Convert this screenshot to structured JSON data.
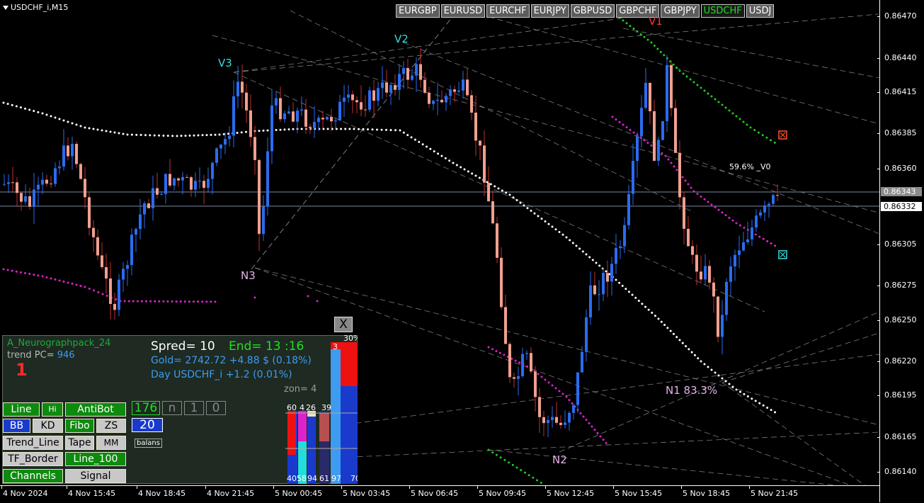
{
  "symbol": {
    "title": "USDCHF_i,M15"
  },
  "pairs": [
    {
      "label": "EURGBP",
      "active": false
    },
    {
      "label": "EURUSD",
      "active": false
    },
    {
      "label": "EURCHF",
      "active": false
    },
    {
      "label": "EURJPY",
      "active": false
    },
    {
      "label": "GBPUSD",
      "active": false
    },
    {
      "label": "GBPCHF",
      "active": false
    },
    {
      "label": "GBPJPY",
      "active": false
    },
    {
      "label": "USDCHF",
      "active": true
    },
    {
      "label": "USDJ",
      "active": false
    }
  ],
  "price_axis": {
    "labels": [
      "0.86470",
      "0.86440",
      "0.86415",
      "0.86385",
      "0.86360",
      "0.86305",
      "0.86275",
      "0.86250",
      "0.86220",
      "0.86195",
      "0.86165",
      "0.86140"
    ],
    "marker_upper": "0.86343",
    "marker_lower": "0.86332"
  },
  "time_axis": {
    "labels": [
      "4 Nov 2024",
      "4 Nov 15:45",
      "4 Nov 18:45",
      "4 Nov 21:45",
      "5 Nov 00:45",
      "5 Nov 03:45",
      "5 Nov 06:45",
      "5 Nov 09:45",
      "5 Nov 12:45",
      "5 Nov 15:45",
      "5 Nov 18:45",
      "5 Nov 21:45"
    ]
  },
  "wave_labels": {
    "v1": "V1",
    "v2": "V2",
    "v3": "V3",
    "n1": "N1 83.3%",
    "n2": "N2",
    "n3": "N3",
    "fib": "59.6% _V0"
  },
  "panel": {
    "indicator_name": "A_Neurographpack_24",
    "trend_pc_label": "trend PC=",
    "trend_pc_value": "946",
    "signal_number": "1",
    "spred": "Spred= 10",
    "end": "End= 13 :16",
    "gold": "Gold= 2742.72 +4.88 $ (0.18%)",
    "day": "Day USDCHF_i   +1.2 (0.01%)",
    "zon": "zon= 4",
    "close_label": "X",
    "balans": "balans",
    "buttons": {
      "line": "Line",
      "hi": "Hi",
      "antibot": "AntiBot",
      "bb": "BB",
      "kd": "KD",
      "fibo": "Fibo",
      "zs": "ZS",
      "trend_line": "Trend_Line",
      "tape": "Tape",
      "mm": "MM",
      "tf_border": "TF_Border",
      "line_100": "Line_100",
      "channels": "Channels",
      "signal": "Signal"
    },
    "counters": {
      "c176": "176",
      "n": "n",
      "one": "1",
      "zero": "0",
      "c20": "20"
    },
    "gauges": {
      "top_pct": "30%",
      "top_small": "3",
      "bottom_pct": "70%",
      "v60": "60",
      "v4": "4",
      "v26": "26",
      "v39": "39",
      "b40": "40",
      "b58": "58",
      "b94": "94",
      "b61": "61",
      "b97": "97"
    }
  },
  "colors": {
    "bull": "#2a6cf0",
    "bear": "#f0a090",
    "white_ma": "#ffffff",
    "magenta_ma": "#dd22cc",
    "green_ma": "#22cc22",
    "cyan": "#33dddd",
    "wave_label": "#e6b3e6"
  }
}
